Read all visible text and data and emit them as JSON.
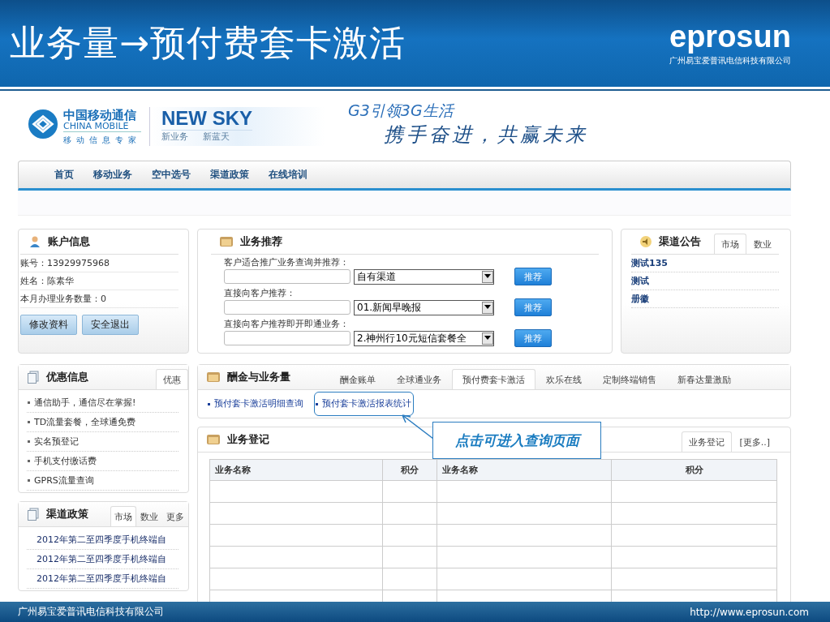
{
  "slide": {
    "title": "业务量→预付费套卡激活",
    "logo": "eprosun",
    "logo_subtitle": "广州易宝爱普讯电信科技有限公司",
    "footer_company": "广州易宝爱普讯电信科技有限公司",
    "footer_url": "http://www.eprosun.com"
  },
  "site_header": {
    "brand_cn": "中国移动通信",
    "brand_en": "CHINA MOBILE",
    "brand_tagline": "移动信息专家",
    "product": "NEW SKY",
    "product_taglines": [
      "新业务",
      "新蓝天"
    ],
    "slogan_1": "G3引领3G生活",
    "slogan_2": "携手奋进，共赢未来"
  },
  "nav": [
    {
      "label": "首页"
    },
    {
      "label": "移动业务"
    },
    {
      "label": "空中选号"
    },
    {
      "label": "渠道政策"
    },
    {
      "label": "在线培训"
    }
  ],
  "account": {
    "title": "账户信息",
    "lines": [
      "账号：13929975968",
      "姓名：陈素华",
      "本月办理业务数量：0"
    ],
    "buttons": [
      "修改资料",
      "安全退出"
    ]
  },
  "recommend": {
    "title": "业务推荐",
    "rows": [
      {
        "label": "客户适合推广业务查询并推荐：",
        "option": "自有渠道",
        "button": "推荐"
      },
      {
        "label": "直接向客户推荐：",
        "option": "01.新闻早晚报",
        "button": "推荐"
      },
      {
        "label": "直接向客户推荐即开即通业务：",
        "option": "2.神州行10元短信套餐全",
        "button": "推荐"
      }
    ]
  },
  "notices": {
    "title": "渠道公告",
    "tabs": [
      {
        "label": "市场",
        "selected": true
      },
      {
        "label": "数业",
        "selected": false
      }
    ],
    "items": [
      "测试135",
      "测试",
      "册徽"
    ]
  },
  "promos": {
    "title": "优惠信息",
    "tabs": [
      {
        "label": "优惠",
        "selected": true
      }
    ],
    "items": [
      "通信助手，通信尽在掌握!",
      "TD流量套餐，全球通免费",
      "实名预登记",
      "手机支付缴话费",
      "GPRS流量查询"
    ]
  },
  "policy": {
    "title": "渠道政策",
    "tabs": [
      {
        "label": "市场",
        "selected": true
      },
      {
        "label": "数业",
        "selected": false
      },
      {
        "label": "更多",
        "selected": false
      }
    ],
    "items": [
      "2012年第二至四季度手机终端自",
      "2012年第二至四季度手机终端自",
      "2012年第二至四季度手机终端自"
    ]
  },
  "commission": {
    "title": "酬金与业务量",
    "tabs": [
      {
        "label": "酬金账单",
        "selected": false
      },
      {
        "label": "全球通业务",
        "selected": false
      },
      {
        "label": "预付费套卡激活",
        "selected": true
      },
      {
        "label": "欢乐在线",
        "selected": false
      },
      {
        "label": "定制终端销售",
        "selected": false
      },
      {
        "label": "新春达量激励",
        "selected": false
      }
    ],
    "links": [
      {
        "label": "预付套卡激活明细查询",
        "highlighted": false
      },
      {
        "label": "预付套卡激活报表统计",
        "highlighted": true
      }
    ]
  },
  "registration": {
    "title": "业务登记",
    "tabs": [
      {
        "label": "业务登记",
        "selected": true
      },
      {
        "label": "[更多..]",
        "selected": false
      }
    ],
    "table": {
      "columns": [
        "业务名称",
        "积分",
        "业务名称",
        "积分"
      ]
    }
  },
  "callout": {
    "text": "点击可进入查询页面"
  }
}
